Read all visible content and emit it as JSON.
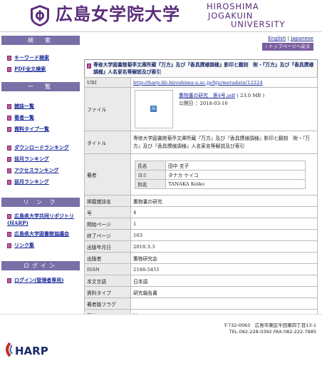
{
  "header": {
    "jp_name": "広島女学院大学",
    "en_lines": [
      "HIROSHIMA",
      "JOGAKUIN",
      "UNIVERSITY"
    ]
  },
  "sidebar": {
    "sections": [
      {
        "head": "検　索",
        "items": [
          "キーワード検索",
          "PDF全文検索"
        ]
      },
      {
        "head": "一　覧",
        "items": [
          "雑誌一覧",
          "著者一覧",
          "資料タイプ一覧",
          "ダウンロードランキング",
          "前月ランキング",
          "アクセスランキング",
          "前月ランキング"
        ]
      },
      {
        "head": "リ ン ク",
        "items": [
          "広島県大学共同リポジトリ(HARP)",
          "広島県大学図書館協議会",
          "リンク集"
        ]
      },
      {
        "head": "ログイン",
        "items": [
          "ログイン(管理者専用)"
        ]
      }
    ]
  },
  "lang": {
    "english": "English",
    "sep": " | ",
    "japanese": "Japanese"
  },
  "toppage_label": "トップページへ戻る",
  "record": {
    "title": "専修大学図書館菊亭文庫所蔵『万方』及び『香具撰様調様』影印と翻刻　附・『万方』及び『香具撰様調様』人名家名等解説及び索引",
    "rows": [
      {
        "label": "URI",
        "value": "http://harp.lib.hiroshima-u.ac.jp/hju/metadata/12224"
      },
      {
        "label": "ファイル"
      },
      {
        "label": "タイトル",
        "value": "専修大学図書館菊亭文庫所蔵『万方』及び『香具撰様調様』影印と翻刻　附・『万方』及び『香具撰様調様』人名家名等解説及び索引"
      },
      {
        "label": "著者"
      },
      {
        "label": "掲載雑誌名",
        "value": "薫物書の研究"
      },
      {
        "label": "号",
        "value": "4"
      },
      {
        "label": "開始ページ",
        "value": "1"
      },
      {
        "label": "終了ページ",
        "value": "163"
      },
      {
        "label": "出版年月日",
        "value": "2018.3.3"
      },
      {
        "label": "出版者",
        "value": "薫物研究会"
      },
      {
        "label": "ISSN",
        "value": "2188-5451"
      },
      {
        "label": "本文言語",
        "value": "日本語"
      },
      {
        "label": "資料タイプ",
        "value": "研究報告書"
      },
      {
        "label": "著者版フラグ",
        "value": ""
      },
      {
        "label": "区分",
        "value": "hju"
      }
    ],
    "file": {
      "name": "薫物書の研究　第4号.pdf",
      "size": "( 23.0 MB )",
      "date_label": "公開日 ：2018-03-16"
    },
    "author": {
      "rows": [
        {
          "label": "氏名",
          "value": "田中 圭子"
        },
        {
          "label": "ヨミ",
          "value": "タナカ ケイコ"
        },
        {
          "label": "別名",
          "value": "TANAKA Keiko"
        }
      ]
    }
  },
  "footer": {
    "address_line1": "〒732-0063　広島市東区牛田東四丁目13-1",
    "address_line2": "TEL:082-228-0392 FAX:082-222-7885",
    "harp": "HARP"
  },
  "colors": {
    "brand_purple": "#5b2d7a",
    "side_head": "#7a6fa6",
    "link": "#1a2a9a"
  }
}
